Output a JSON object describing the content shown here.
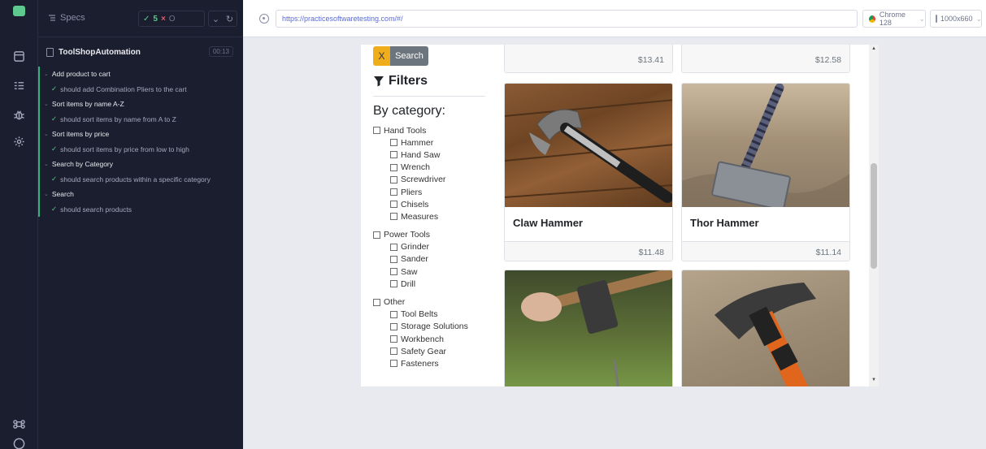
{
  "sidebar_panel": {
    "title": "Specs",
    "stats": {
      "passed": "5",
      "failed": "×",
      "pending": "O"
    },
    "spec_file": {
      "name": "ToolShopAutomation",
      "duration": "00:13"
    },
    "tests": [
      {
        "kind": "suite",
        "label": "Add product to cart"
      },
      {
        "kind": "test",
        "label": "should add Combination Pliers to the cart"
      },
      {
        "kind": "suite",
        "label": "Sort items by name A-Z"
      },
      {
        "kind": "test",
        "label": "should sort items by name from A to Z"
      },
      {
        "kind": "suite",
        "label": "Sort items by price"
      },
      {
        "kind": "test",
        "label": "should sort items by price from low to high"
      },
      {
        "kind": "suite",
        "label": "Search by Category"
      },
      {
        "kind": "test",
        "label": "should search products within a specific category"
      },
      {
        "kind": "suite",
        "label": "Search"
      },
      {
        "kind": "test",
        "label": "should search products"
      }
    ]
  },
  "browser": {
    "url": "https://practicesoftwaretesting.com/#/",
    "name": "Chrome 128",
    "viewport": "1000x660"
  },
  "app": {
    "search": {
      "clear_label": "X",
      "button_label": "Search"
    },
    "filters_title": "Filters",
    "by_category_title": "By category:",
    "categories": [
      {
        "label": "Hand Tools",
        "level": 0
      },
      {
        "label": "Hammer",
        "level": 1
      },
      {
        "label": "Hand Saw",
        "level": 1
      },
      {
        "label": "Wrench",
        "level": 1
      },
      {
        "label": "Screwdriver",
        "level": 1
      },
      {
        "label": "Pliers",
        "level": 1
      },
      {
        "label": "Chisels",
        "level": 1
      },
      {
        "label": "Measures",
        "level": 1
      },
      {
        "label": "Power Tools",
        "level": 0
      },
      {
        "label": "Grinder",
        "level": 1
      },
      {
        "label": "Sander",
        "level": 1
      },
      {
        "label": "Saw",
        "level": 1
      },
      {
        "label": "Drill",
        "level": 1
      },
      {
        "label": "Other",
        "level": 0
      },
      {
        "label": "Tool Belts",
        "level": 1
      },
      {
        "label": "Storage Solutions",
        "level": 1
      },
      {
        "label": "Workbench",
        "level": 1
      },
      {
        "label": "Safety Gear",
        "level": 1
      },
      {
        "label": "Fasteners",
        "level": 1
      }
    ],
    "products": [
      {
        "name": "",
        "price": "$13.41"
      },
      {
        "name": "",
        "price": "$12.58"
      },
      {
        "name": "Claw Hammer",
        "price": "$11.48"
      },
      {
        "name": "Thor Hammer",
        "price": "$11.14"
      },
      {
        "name": "",
        "price": ""
      },
      {
        "name": "",
        "price": ""
      }
    ]
  },
  "colors": {
    "pass": "#5dc98e",
    "fail": "#e45a6a",
    "accent": "#f0ad1b",
    "panel": "#1b1e2e"
  }
}
